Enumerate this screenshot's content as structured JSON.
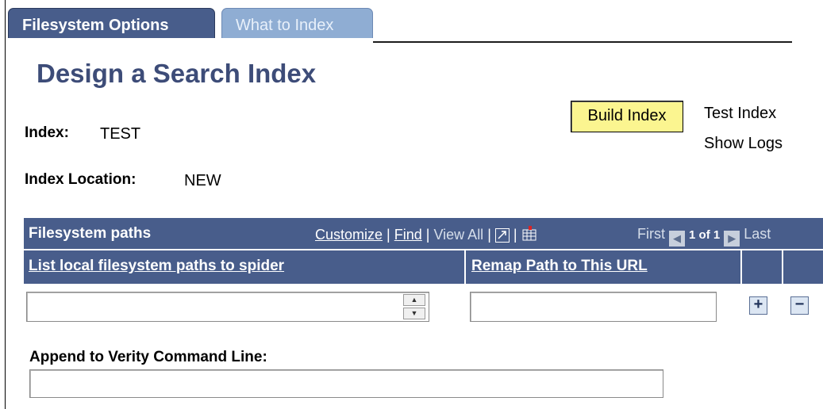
{
  "tabs": [
    {
      "label": "Filesystem Options",
      "active": true
    },
    {
      "label": "What to Index",
      "active": false
    }
  ],
  "page_title": "Design a Search Index",
  "index": {
    "label": "Index:",
    "value": "TEST"
  },
  "index_location": {
    "label": "Index Location:",
    "value": "NEW"
  },
  "actions": {
    "build_label": "Build Index",
    "test_label": "Test Index",
    "logs_label": "Show Logs"
  },
  "grid": {
    "title": "Filesystem paths",
    "customize": "Customize",
    "find": "Find",
    "view_all": "View All",
    "sep": "|",
    "first": "First",
    "range": "1 of 1",
    "last": "Last",
    "columns": [
      "List local filesystem paths to spider",
      "Remap Path to This URL"
    ],
    "row": {
      "path": "",
      "url": ""
    },
    "add_label": "+",
    "remove_label": "−"
  },
  "append": {
    "label": "Append to Verity Command Line:",
    "value": ""
  },
  "colors": {
    "accent": "#485d8b",
    "title": "#3d4c78",
    "button": "#fbf590",
    "tab_inactive": "#8fadd3"
  }
}
